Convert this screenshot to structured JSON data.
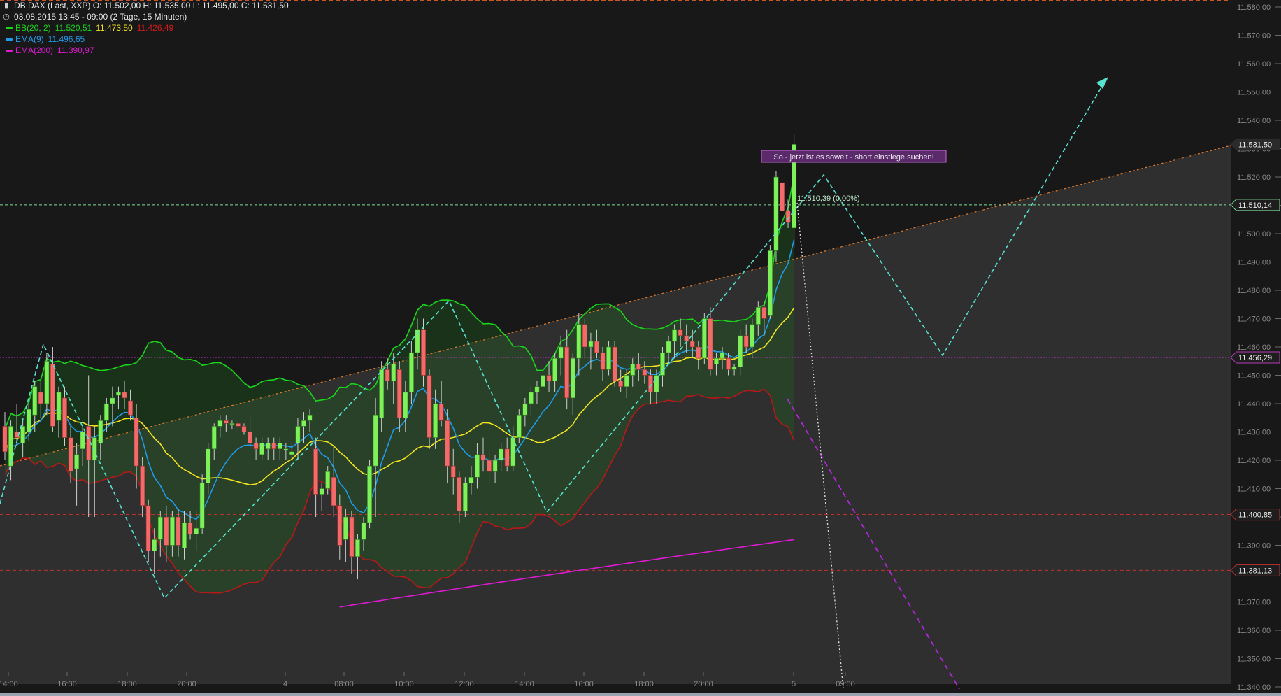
{
  "header": {
    "symbol_icon": "candlestick-icon",
    "symbol_line": "DB DAX (Last, XXP)   O: 11.502,00   H: 11.535,00   L: 11.495,00   C: 11.531,50",
    "clock_icon": "clock-icon",
    "period_line": "03.08.2015 13:45 - 09:00 (2 Tage, 15 Minuten)"
  },
  "indicators": [
    {
      "name": "BB(20, 2)",
      "values": [
        "11.520,51",
        "11.473,50",
        "11.426,49"
      ],
      "colors": [
        "#19d619",
        "#f2e41c",
        "#d21a1a"
      ]
    },
    {
      "name": "EMA(9)",
      "values": [
        "11.496,65"
      ],
      "colors": [
        "#1f9bea"
      ]
    },
    {
      "name": "EMA(200)",
      "values": [
        "11.390,97"
      ],
      "colors": [
        "#e01ad3"
      ]
    }
  ],
  "annotation": "So - jetzt ist es soweit - short einstiege suchen!",
  "level_label": "11.510,39 (0,00%)",
  "chart_data": {
    "type": "candlestick",
    "ylim": [
      11340,
      11580
    ],
    "y_ticks": [
      "11.340,00",
      "11.350,00",
      "11.360,00",
      "11.370,00",
      "11.380,00",
      "11.390,00",
      "11.400,00",
      "11.410,00",
      "11.420,00",
      "11.430,00",
      "11.440,00",
      "11.450,00",
      "11.460,00",
      "11.470,00",
      "11.480,00",
      "11.490,00",
      "11.500,00",
      "11.510,00",
      "11.520,00",
      "11.530,00",
      "11.540,00",
      "11.550,00",
      "11.560,00",
      "11.570,00",
      "11.580,00"
    ],
    "x_ticks": [
      "14:00",
      "16:00",
      "18:00",
      "20:00",
      "4",
      "08:00",
      "10:00",
      "12:00",
      "14:00",
      "16:00",
      "18:00",
      "20:00",
      "5",
      "09:00"
    ],
    "price_labels": [
      {
        "text": "11.531,50",
        "value": 11531.5,
        "kind": "last",
        "color": "#2a2a2a"
      },
      {
        "text": "11.510,14",
        "value": 11510.14,
        "kind": "level",
        "color": "#7ddc9a"
      },
      {
        "text": "11.456,29",
        "value": 11456.29,
        "kind": "level",
        "color": "#b83ab8"
      },
      {
        "text": "11.400,85",
        "value": 11400.85,
        "kind": "level",
        "color": "#c03030"
      },
      {
        "text": "11.381,13",
        "value": 11381.13,
        "kind": "level",
        "color": "#c03030"
      }
    ],
    "candles": [
      [
        11432,
        11437,
        11420,
        11423
      ],
      [
        11418,
        11434,
        11413,
        11432
      ],
      [
        11430,
        11440,
        11425,
        11428
      ],
      [
        11426,
        11435,
        11421,
        11432
      ],
      [
        11430,
        11440,
        11427,
        11438
      ],
      [
        11436,
        11448,
        11430,
        11446
      ],
      [
        11444,
        11448,
        11435,
        11440
      ],
      [
        11440,
        11458,
        11436,
        11455
      ],
      [
        11454,
        11460,
        11430,
        11432
      ],
      [
        11434,
        11446,
        11428,
        11444
      ],
      [
        11442,
        11446,
        11425,
        11428
      ],
      [
        11428,
        11432,
        11412,
        11416
      ],
      [
        11417,
        11426,
        11404,
        11422
      ],
      [
        11424,
        11432,
        11418,
        11430
      ],
      [
        11432,
        11450,
        11400,
        11420
      ],
      [
        11420,
        11432,
        11400,
        11428
      ],
      [
        11426,
        11436,
        11420,
        11434
      ],
      [
        11434,
        11442,
        11430,
        11440
      ],
      [
        11440,
        11446,
        11432,
        11442
      ],
      [
        11443,
        11446,
        11438,
        11444
      ],
      [
        11444,
        11448,
        11438,
        11442
      ],
      [
        11441,
        11445,
        11434,
        11436
      ],
      [
        11435,
        11440,
        11410,
        11418
      ],
      [
        11418,
        11421,
        11400,
        11404
      ],
      [
        11404,
        11406,
        11384,
        11388
      ],
      [
        11388,
        11396,
        11380,
        11392
      ],
      [
        11392,
        11402,
        11386,
        11400
      ],
      [
        11400,
        11404,
        11384,
        11390
      ],
      [
        11390,
        11402,
        11386,
        11400
      ],
      [
        11400,
        11403,
        11386,
        11390
      ],
      [
        11389,
        11402,
        11385,
        11398
      ],
      [
        11398,
        11402,
        11392,
        11394
      ],
      [
        11394,
        11402,
        11388,
        11396
      ],
      [
        11396,
        11415,
        11394,
        11412
      ],
      [
        11412,
        11426,
        11408,
        11424
      ],
      [
        11424,
        11433,
        11420,
        11432
      ],
      [
        11432,
        11436,
        11428,
        11434
      ],
      [
        11434,
        11436,
        11430,
        11433
      ],
      [
        11433,
        11434,
        11431,
        11433
      ],
      [
        11433,
        11434,
        11431,
        11432
      ],
      [
        11432,
        11433,
        11429,
        11430
      ],
      [
        11430,
        11436,
        11424,
        11426
      ],
      [
        11426,
        11428,
        11420,
        11424
      ],
      [
        11422,
        11428,
        11420,
        11426
      ],
      [
        11424,
        11428,
        11420,
        11426
      ],
      [
        11426,
        11428,
        11420,
        11424
      ],
      [
        11424,
        11428,
        11420,
        11426
      ],
      [
        11424,
        11426,
        11420,
        11424
      ],
      [
        11422,
        11426,
        11420,
        11423
      ],
      [
        11426,
        11435,
        11420,
        11432
      ],
      [
        11432,
        11437,
        11426,
        11434
      ],
      [
        11434,
        11438,
        11430,
        11436
      ],
      [
        11424,
        11428,
        11400,
        11408
      ],
      [
        11408,
        11412,
        11402,
        11410
      ],
      [
        11410,
        11418,
        11408,
        11416
      ],
      [
        11414,
        11425,
        11400,
        11404
      ],
      [
        11404,
        11408,
        11385,
        11390
      ],
      [
        11392,
        11403,
        11384,
        11400
      ],
      [
        11400,
        11402,
        11380,
        11386
      ],
      [
        11386,
        11394,
        11378,
        11392
      ],
      [
        11392,
        11400,
        11388,
        11398
      ],
      [
        11398,
        11420,
        11396,
        11418
      ],
      [
        11418,
        11442,
        11400,
        11436
      ],
      [
        11435,
        11455,
        11430,
        11452
      ],
      [
        11452,
        11456,
        11445,
        11448
      ],
      [
        11448,
        11458,
        11440,
        11454
      ],
      [
        11452,
        11455,
        11430,
        11435
      ],
      [
        11435,
        11448,
        11430,
        11444
      ],
      [
        11444,
        11462,
        11440,
        11458
      ],
      [
        11458,
        11470,
        11452,
        11466
      ],
      [
        11466,
        11470,
        11446,
        11450
      ],
      [
        11450,
        11452,
        11424,
        11428
      ],
      [
        11428,
        11445,
        11424,
        11440
      ],
      [
        11440,
        11448,
        11432,
        11434
      ],
      [
        11434,
        11438,
        11412,
        11418
      ],
      [
        11418,
        11424,
        11408,
        11414
      ],
      [
        11414,
        11416,
        11398,
        11402
      ],
      [
        11402,
        11414,
        11400,
        11412
      ],
      [
        11412,
        11418,
        11408,
        11414
      ],
      [
        11414,
        11426,
        11410,
        11422
      ],
      [
        11422,
        11428,
        11416,
        11420
      ],
      [
        11420,
        11424,
        11412,
        11416
      ],
      [
        11416,
        11422,
        11412,
        11420
      ],
      [
        11420,
        11426,
        11416,
        11424
      ],
      [
        11424,
        11428,
        11416,
        11418
      ],
      [
        11418,
        11432,
        11416,
        11428
      ],
      [
        11428,
        11438,
        11426,
        11436
      ],
      [
        11436,
        11442,
        11432,
        11440
      ],
      [
        11440,
        11446,
        11436,
        11444
      ],
      [
        11444,
        11448,
        11440,
        11446
      ],
      [
        11446,
        11452,
        11442,
        11450
      ],
      [
        11450,
        11455,
        11444,
        11448
      ],
      [
        11448,
        11458,
        11444,
        11456
      ],
      [
        11456,
        11464,
        11450,
        11460
      ],
      [
        11460,
        11466,
        11438,
        11442
      ],
      [
        11442,
        11458,
        11436,
        11456
      ],
      [
        11456,
        11472,
        11450,
        11468
      ],
      [
        11468,
        11470,
        11456,
        11460
      ],
      [
        11460,
        11465,
        11452,
        11462
      ],
      [
        11462,
        11466,
        11456,
        11458
      ],
      [
        11458,
        11460,
        11448,
        11452
      ],
      [
        11452,
        11462,
        11450,
        11460
      ],
      [
        11460,
        11462,
        11446,
        11448
      ],
      [
        11448,
        11452,
        11444,
        11446
      ],
      [
        11446,
        11452,
        11442,
        11450
      ],
      [
        11450,
        11456,
        11446,
        11454
      ],
      [
        11454,
        11458,
        11448,
        11452
      ],
      [
        11452,
        11455,
        11447,
        11450
      ],
      [
        11450,
        11452,
        11440,
        11444
      ],
      [
        11444,
        11452,
        11440,
        11450
      ],
      [
        11450,
        11460,
        11446,
        11458
      ],
      [
        11458,
        11464,
        11454,
        11462
      ],
      [
        11462,
        11468,
        11456,
        11466
      ],
      [
        11466,
        11470,
        11460,
        11464
      ],
      [
        11464,
        11468,
        11458,
        11462
      ],
      [
        11462,
        11466,
        11456,
        11460
      ],
      [
        11460,
        11462,
        11452,
        11456
      ],
      [
        11456,
        11472,
        11454,
        11470
      ],
      [
        11470,
        11474,
        11450,
        11452
      ],
      [
        11454,
        11458,
        11450,
        11456
      ],
      [
        11456,
        11460,
        11452,
        11458
      ],
      [
        11456,
        11458,
        11450,
        11452
      ],
      [
        11452,
        11454,
        11450,
        11453
      ],
      [
        11453,
        11466,
        11450,
        11464
      ],
      [
        11464,
        11468,
        11458,
        11460
      ],
      [
        11460,
        11470,
        11456,
        11468
      ],
      [
        11468,
        11476,
        11464,
        11474
      ],
      [
        11474,
        11476,
        11464,
        11470
      ],
      [
        11471,
        11496,
        11470,
        11494
      ],
      [
        11494,
        11522,
        11490,
        11520
      ],
      [
        11518,
        11522,
        11505,
        11508
      ],
      [
        11508,
        11512,
        11502,
        11504
      ],
      [
        11502,
        11535,
        11495,
        11531.5
      ]
    ]
  }
}
